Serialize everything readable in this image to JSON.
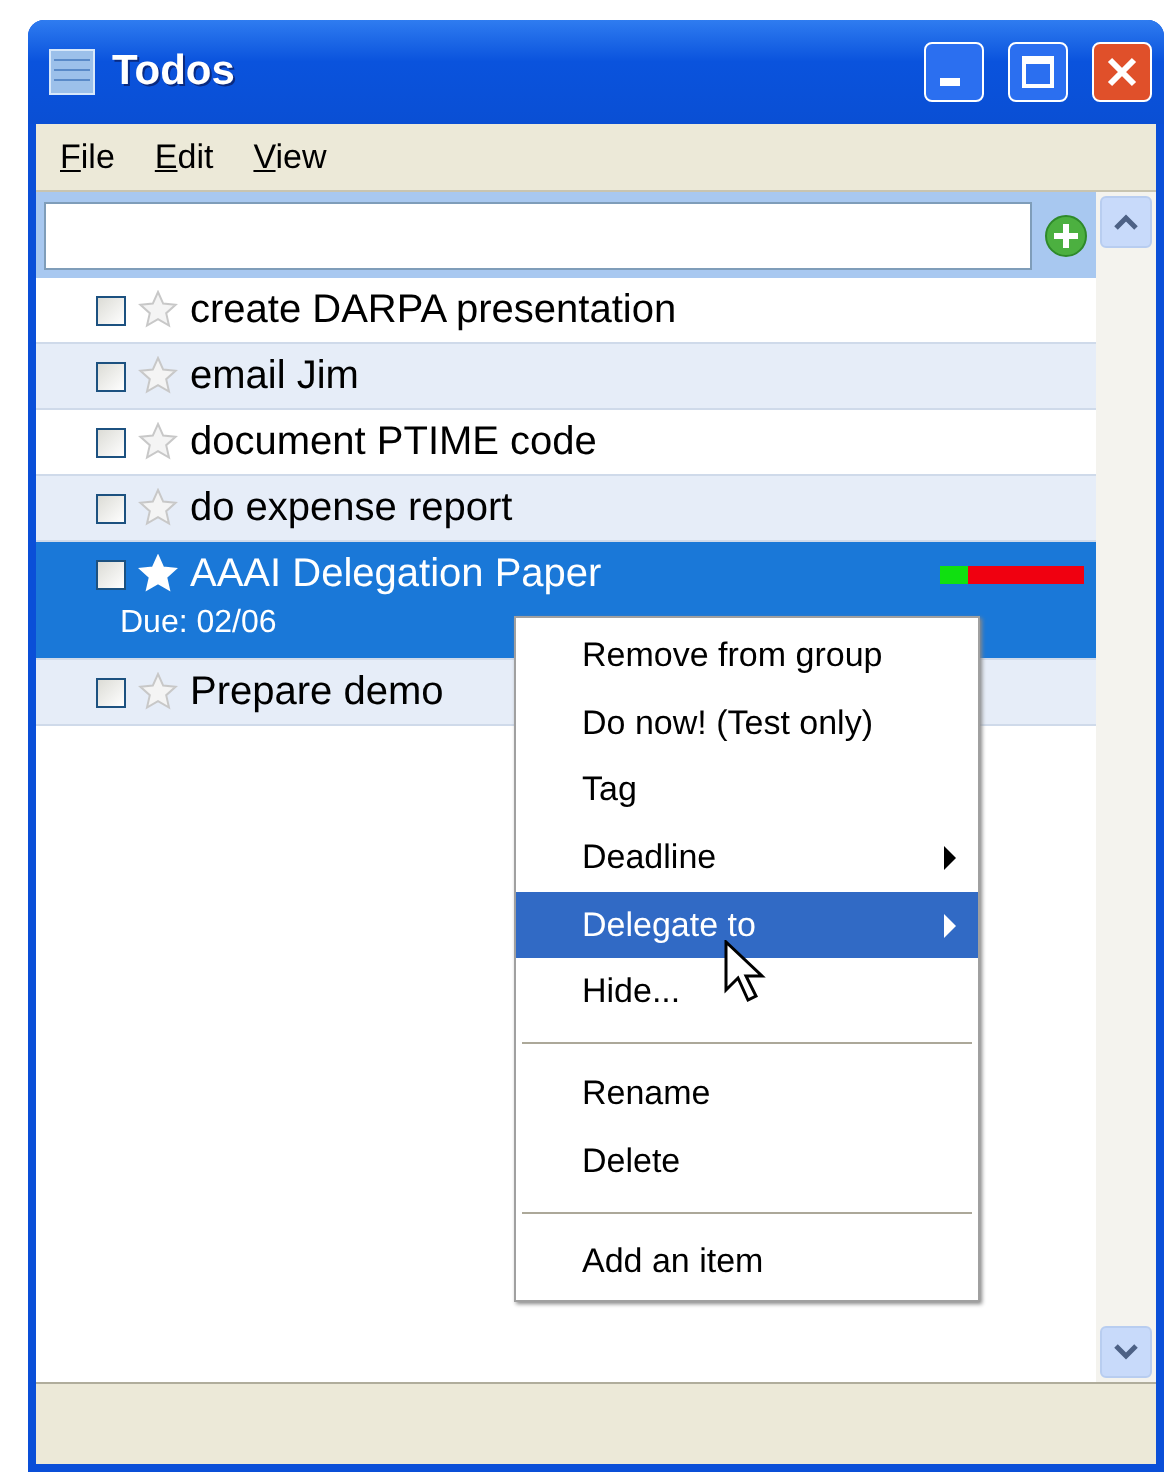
{
  "window": {
    "title": "Todos"
  },
  "menu_bar": [
    "File",
    "Edit",
    "View"
  ],
  "todos": [
    {
      "text": "create DARPA presentation",
      "checked": false,
      "starred": false,
      "selected": false
    },
    {
      "text": "email Jim",
      "checked": false,
      "starred": false,
      "selected": false
    },
    {
      "text": "document PTIME code",
      "checked": false,
      "starred": false,
      "selected": false
    },
    {
      "text": "do expense report",
      "checked": false,
      "starred": false,
      "selected": false
    },
    {
      "text": "AAAI Delegation Paper",
      "checked": false,
      "starred": true,
      "selected": true,
      "due": "Due: 02/06",
      "level": 0.2
    },
    {
      "text": "Prepare demo",
      "checked": false,
      "starred": false,
      "selected": false
    }
  ],
  "context_menu": [
    {
      "kind": "item",
      "label": "Remove from group",
      "selected": false
    },
    {
      "kind": "item",
      "label": "Do now! (Test only)",
      "selected": false
    },
    {
      "kind": "item",
      "label": "Tag",
      "selected": false
    },
    {
      "kind": "submenu",
      "label": "Deadline",
      "selected": false
    },
    {
      "kind": "submenu",
      "label": "Delegate to",
      "selected": true
    },
    {
      "kind": "item",
      "label": "Hide...",
      "selected": false
    },
    {
      "kind": "separator"
    },
    {
      "kind": "item",
      "label": "Rename",
      "selected": false
    },
    {
      "kind": "item",
      "label": "Delete",
      "selected": false
    },
    {
      "kind": "separator"
    },
    {
      "kind": "item",
      "label": "Add an item",
      "selected": false
    }
  ]
}
